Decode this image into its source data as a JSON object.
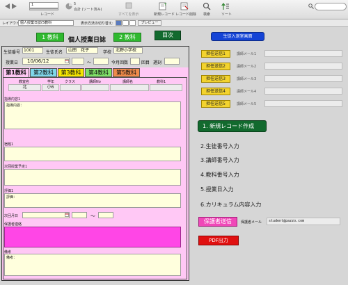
{
  "toolbar": {
    "record_number": "1",
    "record_label": "レコード",
    "count": "5",
    "count_label": "合計 (ソート済み)",
    "show_all": "すべてを表示",
    "new_record": "新規レコード",
    "delete_record": "レコード削除",
    "find": "検索",
    "sort": "ソート"
  },
  "layoutbar": {
    "layout_label": "レイアウト:",
    "layout_value": "個人授業日誌(5教科",
    "view_as": "表示方法の切り替え:",
    "preview": "プレビュー"
  },
  "header": {
    "subject1_button": "1 教科",
    "title": "個人授業日誌",
    "subject2_button": "2 教科",
    "toc_button": "目次",
    "student_entry_button": "生徒入退室画面"
  },
  "form": {
    "student_no_label": "生徒番号",
    "student_no": "1001",
    "student_name_label": "生徒氏名",
    "student_name": "山田　花子",
    "school_label": "学校",
    "school": "北野小学校",
    "class_date_label": "授業日",
    "class_date": "10/06/12",
    "tilde": "～",
    "session_count_label": "今月回数",
    "session_unit": "回目",
    "late_label": "遅刻",
    "tabs": [
      "第1教科",
      "第2教科",
      "第3教科",
      "第4教科",
      "第5教科"
    ],
    "cols": [
      "教室名",
      "学年",
      "クラス",
      "講師No",
      "講師名",
      "教科1"
    ],
    "row": [
      "北",
      "小6",
      "",
      "",
      "",
      ""
    ],
    "guidance_label": "指導内容1",
    "guidance_placeholder": "指導内容：",
    "homework_label": "宿題1",
    "next_plan_label": "次回授業予定1",
    "evaluation_label": "評価1",
    "evaluation_placeholder": "評価：",
    "next_date_label": "次回月日",
    "guardian_label": "保護者連絡",
    "remarks_label": "備考",
    "remarks_placeholder": "備考："
  },
  "teacher_send": {
    "buttons": [
      "担任送信1",
      "担任送信2",
      "担任送信3",
      "担任送信4",
      "担任送信5"
    ],
    "labels": [
      "講師メール1",
      "講師メール2",
      "講師メール3",
      "講師メール4",
      "講師メール5"
    ]
  },
  "steps": {
    "step1": "1. 新規レコード作成",
    "step2": "2.生徒番号入力",
    "step3": "3.講師番号入力",
    "step4": "4.教科番号入力",
    "step5": "5.授業日入力",
    "step6": "6.カリキュラム内容入力"
  },
  "guardian_send": {
    "button": "保護者送信",
    "mail_label": "保護者メール",
    "mail_value": "student@pazzo.com"
  },
  "pdf_button": "PDF出力",
  "colors": {
    "accent_green": "#2fb92f",
    "dark_green": "#126a2e",
    "blue": "#1544d6",
    "yellow": "#f3d32e",
    "pink": "#f048b8",
    "red": "#e01010",
    "form_bg": "#ffc8f5"
  }
}
